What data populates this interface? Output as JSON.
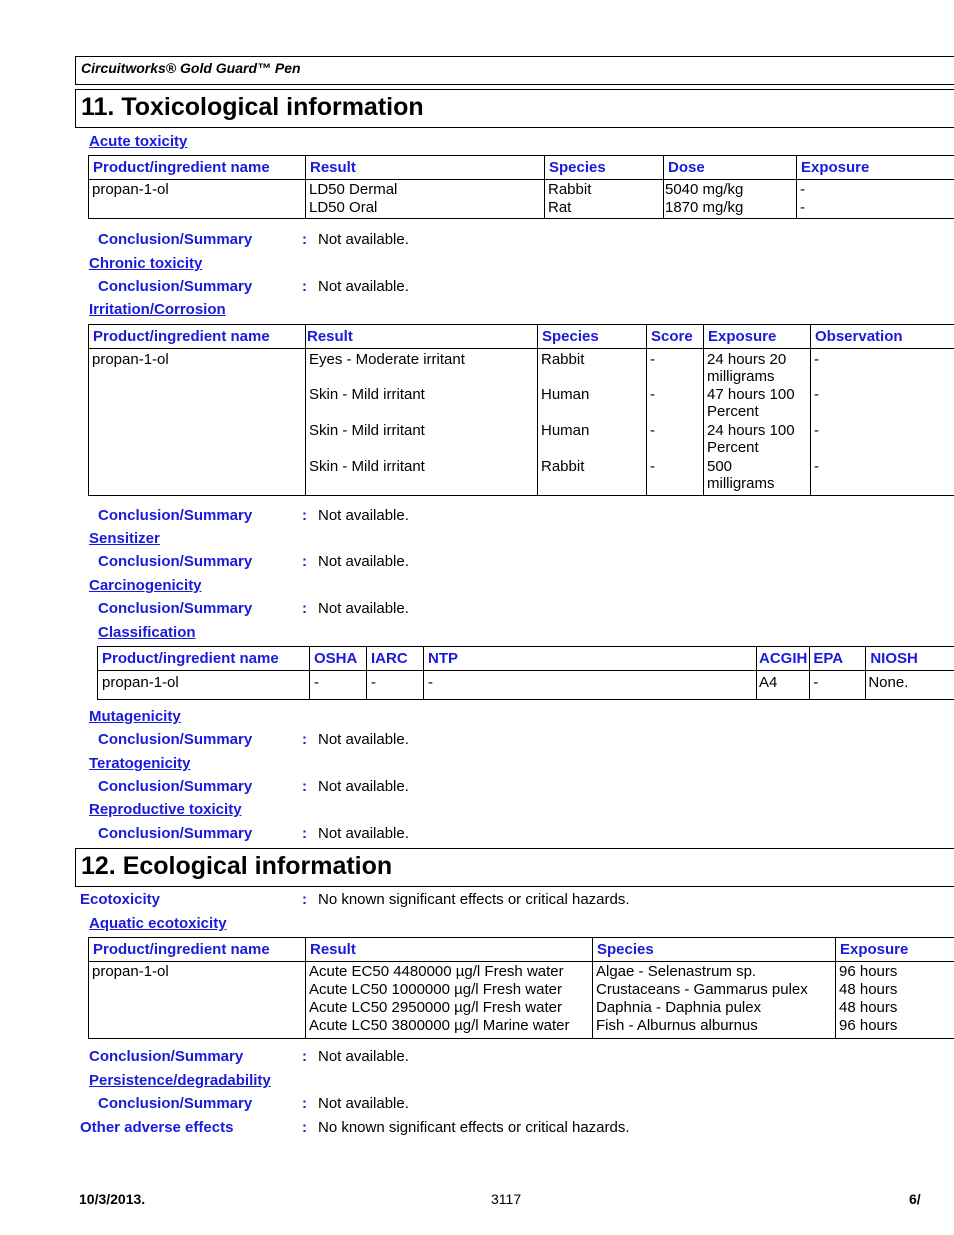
{
  "header": {
    "product_title": "Circuitworks® Gold Guard™ Pen"
  },
  "section11": {
    "title": "11. Toxicological information",
    "acute_toxicity": {
      "heading": "Acute toxicity",
      "columns": [
        "Product/ingredient name",
        "Result",
        "Species",
        "Dose",
        "Exposure"
      ],
      "rows": [
        {
          "name": "propan-1-ol",
          "result": [
            "LD50 Dermal",
            "LD50 Oral"
          ],
          "species": [
            "Rabbit",
            "Rat"
          ],
          "dose": [
            "5040 mg/kg",
            "1870 mg/kg"
          ],
          "exposure": [
            "-",
            "-"
          ]
        }
      ],
      "conclusion_label": "Conclusion/Summary",
      "conclusion_value": "Not available."
    },
    "chronic_toxicity": {
      "heading": "Chronic toxicity",
      "conclusion_label": "Conclusion/Summary",
      "conclusion_value": "Not available."
    },
    "irritation": {
      "heading": "Irritation/Corrosion",
      "columns": [
        "Product/ingredient name",
        "Result",
        "Species",
        "Score",
        "Exposure",
        "Observation"
      ],
      "name": "propan-1-ol",
      "rows": [
        {
          "result": "Eyes - Moderate irritant",
          "species": "Rabbit",
          "score": "-",
          "exposure": [
            "24 hours 20",
            "milligrams"
          ],
          "observation": "-"
        },
        {
          "result": "Skin - Mild irritant",
          "species": "Human",
          "score": "-",
          "exposure": [
            "47 hours 100",
            "Percent"
          ],
          "observation": "-"
        },
        {
          "result": "Skin - Mild irritant",
          "species": "Human",
          "score": "-",
          "exposure": [
            "24 hours 100",
            "Percent"
          ],
          "observation": "-"
        },
        {
          "result": "Skin - Mild irritant",
          "species": "Rabbit",
          "score": "-",
          "exposure": [
            "500",
            "milligrams"
          ],
          "observation": "-"
        }
      ],
      "conclusion_label": "Conclusion/Summary",
      "conclusion_value": "Not available."
    },
    "sensitizer": {
      "heading": "Sensitizer",
      "conclusion_label": "Conclusion/Summary",
      "conclusion_value": "Not available."
    },
    "carcinogenicity": {
      "heading": "Carcinogenicity",
      "conclusion_label": "Conclusion/Summary",
      "conclusion_value": "Not available.",
      "classification": {
        "heading": "Classification",
        "columns": [
          "Product/ingredient name",
          "OSHA",
          "IARC",
          "NTP",
          "ACGIH",
          "EPA",
          "NIOSH"
        ],
        "rows": [
          [
            "propan-1-ol",
            "-",
            "-",
            "-",
            "A4",
            "-",
            "None."
          ]
        ]
      }
    },
    "mutagenicity": {
      "heading": "Mutagenicity",
      "conclusion_label": "Conclusion/Summary",
      "conclusion_value": "Not available."
    },
    "teratogenicity": {
      "heading": "Teratogenicity",
      "conclusion_label": "Conclusion/Summary",
      "conclusion_value": "Not available."
    },
    "reproductive": {
      "heading": "Reproductive toxicity",
      "conclusion_label": "Conclusion/Summary",
      "conclusion_value": "Not available."
    }
  },
  "section12": {
    "title": "12. Ecological information",
    "ecotoxicity_label": "Ecotoxicity",
    "ecotoxicity_value": "No known significant effects or critical hazards.",
    "aquatic": {
      "heading": "Aquatic ecotoxicity",
      "columns": [
        "Product/ingredient name",
        "Result",
        "Species",
        "Exposure"
      ],
      "name": "propan-1-ol",
      "result": [
        "Acute EC50 4480000 µg/l Fresh water",
        "Acute LC50 1000000 µg/l Fresh water",
        "Acute LC50 2950000 µg/l Fresh water",
        "Acute LC50 3800000 µg/l Marine water"
      ],
      "species": [
        "Algae - Selenastrum sp.",
        "Crustaceans - Gammarus pulex",
        "Daphnia - Daphnia pulex",
        "Fish - Alburnus alburnus"
      ],
      "exposure": [
        "96 hours",
        "48 hours",
        "48 hours",
        "96 hours"
      ],
      "conclusion_label": "Conclusion/Summary",
      "conclusion_value": "Not available."
    },
    "persistence": {
      "heading": "Persistence/degradability",
      "conclusion_label": "Conclusion/Summary",
      "conclusion_value": "Not available."
    },
    "other_label": "Other adverse effects",
    "other_value": "No known significant effects or critical hazards."
  },
  "footer": {
    "date": "10/3/2013.",
    "code": "3117",
    "page": "6/"
  },
  "colon": ":"
}
